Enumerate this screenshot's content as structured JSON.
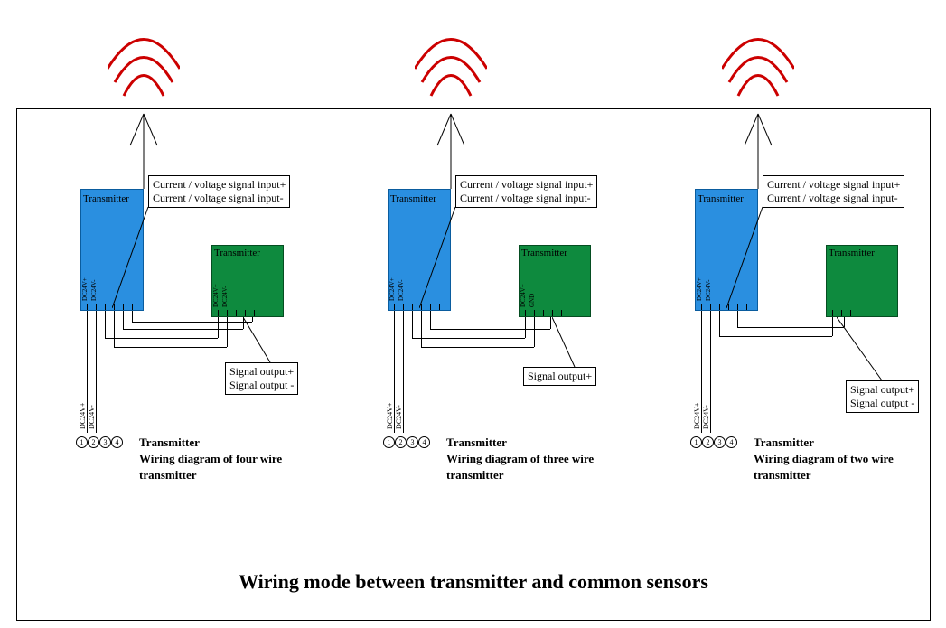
{
  "title": "Wiring mode between transmitter and common sensors",
  "common": {
    "tx_label": "Transmitter",
    "sig_in_plus": "Current / voltage signal input+",
    "sig_in_minus": "Current / voltage signal input-",
    "sig_out_plus": "Signal output+",
    "sig_out_minus": "Signal output -",
    "dc24p": "DC24V+",
    "dc24n": "DC24V-",
    "gnd": "GND",
    "n1": "1",
    "n2": "2",
    "n3": "3",
    "n4": "4"
  },
  "panels": {
    "four": {
      "title1": "Transmitter",
      "title2": "Wiring diagram of four wire transmitter"
    },
    "three": {
      "title1": "Transmitter",
      "title2": "Wiring diagram of three wire transmitter"
    },
    "two": {
      "title1": "Transmitter",
      "title2": "Wiring diagram of two wire",
      "title3": "transmitter"
    }
  }
}
